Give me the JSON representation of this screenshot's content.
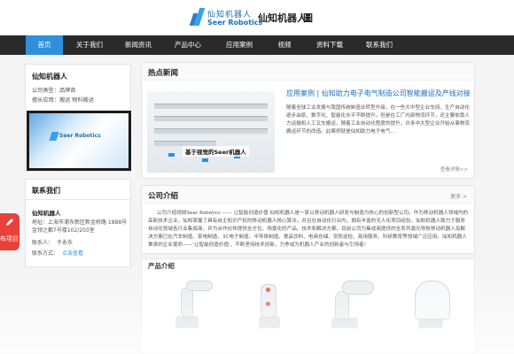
{
  "header": {
    "logo_cn": "仙知机器人",
    "logo_en": "Seer Robotics",
    "brand_title": "仙知机器人",
    "brand_mark": "圖"
  },
  "nav": {
    "items": [
      "首页",
      "关于我们",
      "新闻资讯",
      "产品中心",
      "应用案例",
      "视频",
      "资料下载",
      "联系我们"
    ],
    "active": "首页"
  },
  "company": {
    "name": "仙知机器人",
    "type_label": "公司类型：",
    "type_value": "品牌商",
    "scope_label": "擅长应用：",
    "scope_value": "搬运 物料搬运"
  },
  "contact": {
    "title": "联系我们",
    "company": "仙知机器人",
    "address": "地址：上海市浦东新区新金桥路 1888号金领之都7号楼102/203室",
    "person_label": "联系人：",
    "person_value": "于永东",
    "phone_label": "联系方式：",
    "phone_value": "点击查看"
  },
  "float_tab": {
    "label": "布项目",
    "color": "#e8413a"
  },
  "news": {
    "title": "热点新闻",
    "headline": "应用案例 | 仙知助力电子电气制造公司智能搬运及产线对接",
    "excerpt": "随着全球工业发展与我国传统制造业转型升级，在一些大中型企业车间，生产自动化逐步由原、数字化、智能化水平不断提升。但是在工厂内部物流环节，还主要依靠人力运输和人工叉车搬运，随着工业自动化程度的提升，许多中大型企业开始从事物流搬运环节的改造。此案例就是仙知助力电子电气…",
    "image_caption": "基于视觉的Seer机器人",
    "more": "查看详情>>"
  },
  "intro": {
    "title": "公司介绍",
    "more": "更多 >",
    "text": "公司介绍视频Seer Robotics —— 让智能创造价值 仙知机器人是一家以移动机器人研发与制造为核心的创新型公司。作为移动机器人领域内的高新技术企业，仙知掌握了具有自主知识产权的移动机器人核心算法，并且在自动化行业内，拥有丰富的无人化项目经验。仙知机器人致力于服务自动化领域各行业集成商，并为合作伙伴提供全方位、场景化的产品、技术和解决方案。目前公司为集成商提供的全系列激光导航移动机器人及解决方案已在汽车制造、家电制造、3C电子制造、半导体制造、食品饮料、电商仓储、安防巡检、商用服务、科研教育等领域广泛应用。仙知机器人秉承的企业使命——'让智能创造价值'，不断坚持技术创新，力争成为机器人产业的创新者与引领者！"
  },
  "products": {
    "title": "产品介绍"
  },
  "colors": {
    "accent": "#2f8fdc",
    "nav_bg": "#2a2a2a",
    "float_tab": "#e8413a"
  }
}
